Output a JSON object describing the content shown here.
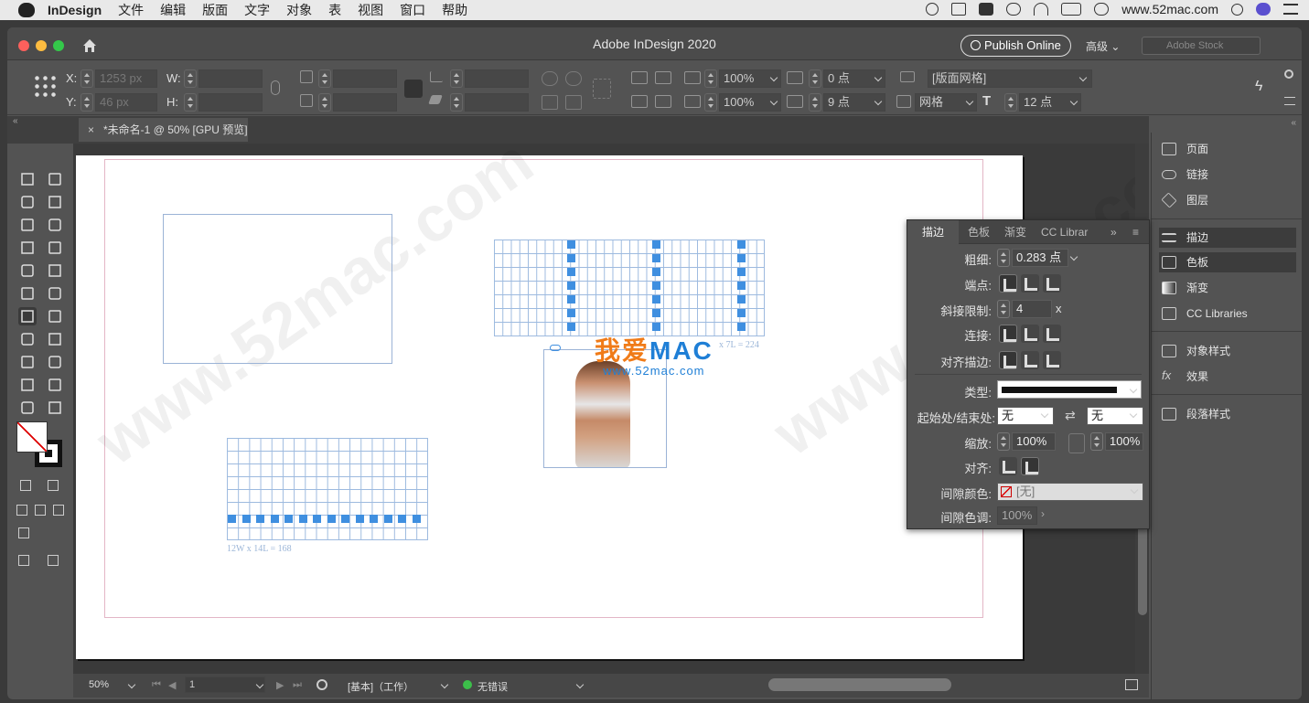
{
  "menubar": {
    "app": "InDesign",
    "items": [
      "文件",
      "编辑",
      "版面",
      "文字",
      "对象",
      "表",
      "视图",
      "窗口",
      "帮助"
    ],
    "url": "www.52mac.com"
  },
  "window": {
    "title": "Adobe InDesign 2020",
    "publish": "Publish Online",
    "workspace": "高级",
    "stock_placeholder": "Adobe Stock"
  },
  "control": {
    "x_label": "X:",
    "x_val": "1253 px",
    "y_label": "Y:",
    "y_val": "46 px",
    "w_label": "W:",
    "h_label": "H:",
    "scale1": "100%",
    "scale2": "100%",
    "offset1": "0 点",
    "offset2": "9 点",
    "grid_dd": "[版面网格]",
    "grid_mode": "网格",
    "size": "12 点"
  },
  "tab": {
    "title": "*未命名-1 @ 50% [GPU 预览]",
    "close": "×"
  },
  "canvas": {
    "caption1": "12W x 14L = 168",
    "caption2": "x 7L = 224",
    "logo_cn": "我爱",
    "logo_en": "MAC",
    "logo_url": "www.52mac.com",
    "watermark": "www.52mac.com"
  },
  "status": {
    "zoom": "50%",
    "page": "1",
    "master": "[基本]（工作）",
    "errors": "无错误"
  },
  "right_panel": {
    "items": [
      "页面",
      "链接",
      "图层",
      "描边",
      "色板",
      "渐变",
      "CC Libraries",
      "对象样式",
      "效果",
      "段落样式"
    ]
  },
  "stroke_panel": {
    "tabs": [
      "描边",
      "色板",
      "渐变",
      "CC Librar"
    ],
    "weight_label": "粗细:",
    "weight": "0.283 点",
    "cap_label": "端点:",
    "miter_label": "斜接限制:",
    "miter": "4",
    "miter_x": "x",
    "join_label": "连接:",
    "align_label": "对齐描边:",
    "type_label": "类型:",
    "startend_label": "起始处/结束处:",
    "start": "无",
    "end": "无",
    "scale_label": "缩放:",
    "scale1": "100%",
    "scale2": "100%",
    "align2_label": "对齐:",
    "gapcolor_label": "间隙颜色:",
    "gapcolor": "[无]",
    "gaptint_label": "间隙色调:",
    "gaptint": "100%"
  }
}
